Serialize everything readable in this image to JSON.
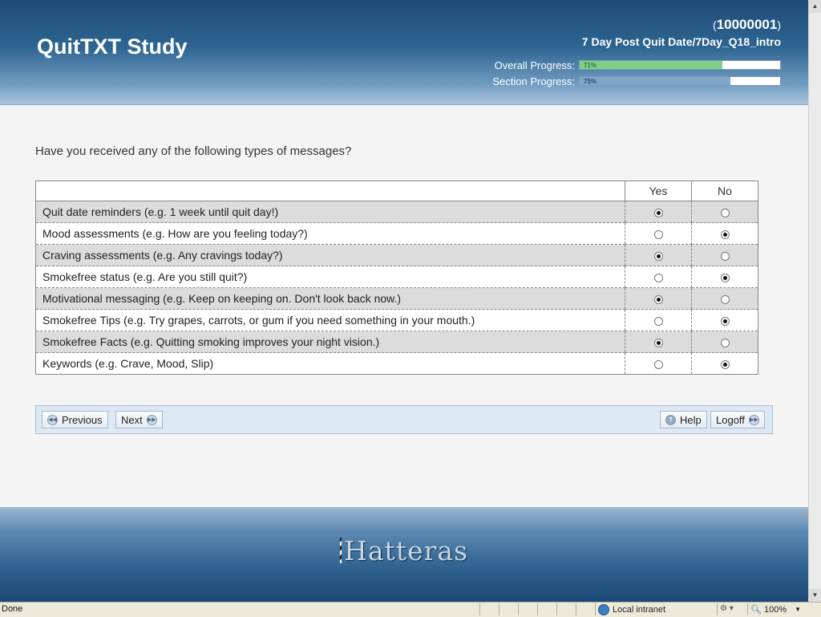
{
  "header": {
    "title": "QuitTXT Study",
    "participant_open": "(",
    "participant_id": "10000001",
    "participant_close": ")",
    "location": "7 Day Post Quit Date/7Day_Q18_intro",
    "overall": {
      "label": "Overall Progress:",
      "percent_text": "71%",
      "value": 0.71,
      "color": "#7fcf86"
    },
    "section": {
      "label": "Section Progress:",
      "percent_text": "75%",
      "value": 0.75,
      "color": "#7fa7c9"
    }
  },
  "question": {
    "text": "Have you received any of the following types of messages?",
    "columns": [
      "Yes",
      "No"
    ],
    "rows": [
      {
        "label": "Quit date reminders (e.g. 1 week until quit day!)",
        "selected": "Yes"
      },
      {
        "label": "Mood assessments (e.g. How are you feeling today?)",
        "selected": "No"
      },
      {
        "label": "Craving assessments (e.g. Any cravings today?)",
        "selected": "Yes"
      },
      {
        "label": "Smokefree status (e.g. Are you still quit?)",
        "selected": "No"
      },
      {
        "label": "Motivational messaging (e.g. Keep on keeping on. Don't look back now.)",
        "selected": "Yes"
      },
      {
        "label": "Smokefree Tips (e.g. Try grapes, carrots, or gum if you need something in your mouth.)",
        "selected": "No"
      },
      {
        "label": "Smokefree Facts (e.g. Quitting smoking improves your night vision.)",
        "selected": "Yes"
      },
      {
        "label": "Keywords (e.g. Crave, Mood, Slip)",
        "selected": "No"
      }
    ]
  },
  "nav": {
    "previous": "Previous",
    "next": "Next",
    "help": "Help",
    "logoff": "Logoff"
  },
  "footer": {
    "logo_text": "Hatteras"
  },
  "statusbar": {
    "status": "Done",
    "zone": "Local intranet",
    "zoom": "100%"
  }
}
